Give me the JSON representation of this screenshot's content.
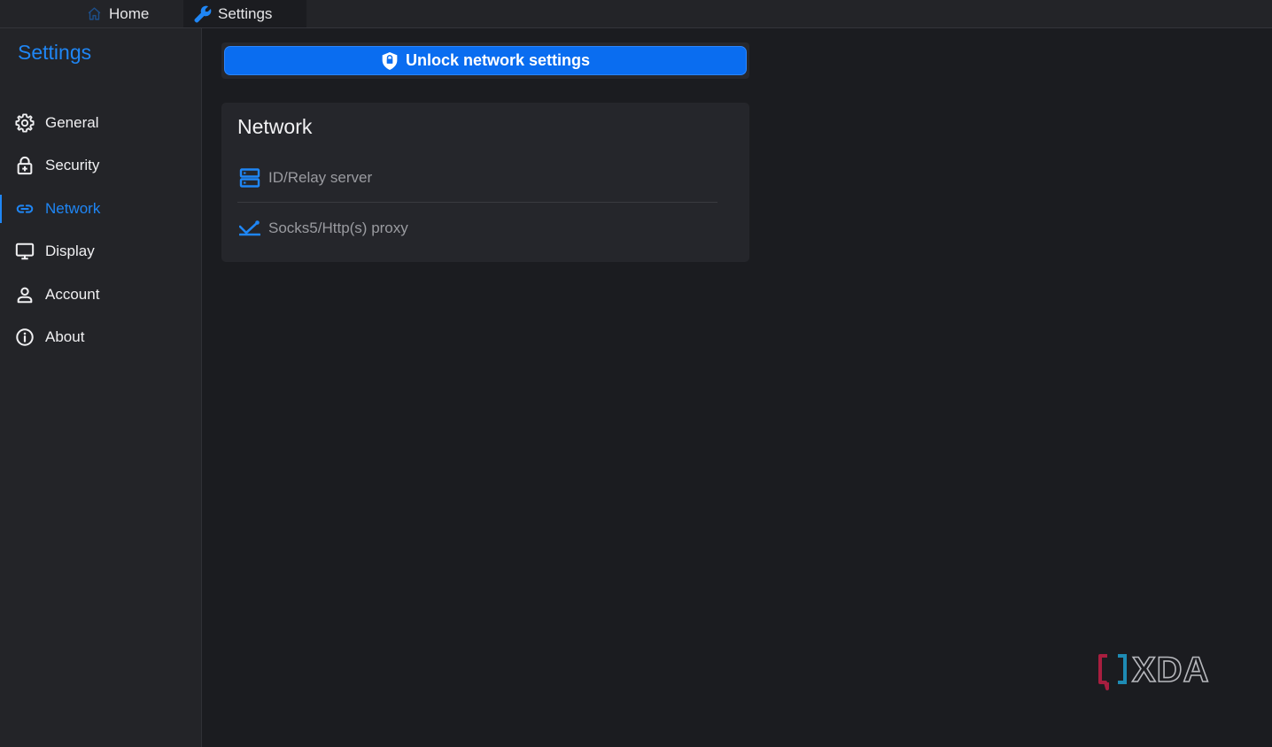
{
  "tabs": [
    {
      "label": "Home",
      "icon": "home-icon"
    },
    {
      "label": "Settings",
      "icon": "wrench-icon",
      "active": true
    }
  ],
  "sidebar": {
    "title": "Settings",
    "items": [
      {
        "label": "General",
        "icon": "gear-icon"
      },
      {
        "label": "Security",
        "icon": "lock-icon"
      },
      {
        "label": "Network",
        "icon": "link-icon",
        "active": true
      },
      {
        "label": "Display",
        "icon": "monitor-icon"
      },
      {
        "label": "Account",
        "icon": "user-icon"
      },
      {
        "label": "About",
        "icon": "info-icon"
      }
    ]
  },
  "main": {
    "unlock_button": {
      "label": "Unlock network settings",
      "icon": "shield-icon"
    },
    "network_card": {
      "title": "Network",
      "rows": [
        {
          "label": "ID/Relay server",
          "icon": "server-icon"
        },
        {
          "label": "Socks5/Http(s) proxy",
          "icon": "proxy-icon"
        }
      ]
    }
  },
  "watermark": {
    "text": "XDA"
  },
  "colors": {
    "accent": "#1f86f5",
    "button": "#0a6df0",
    "background": "#1b1c20",
    "sidebar": "#232428",
    "card": "#25262b",
    "muted_text": "#9a9ba0"
  }
}
